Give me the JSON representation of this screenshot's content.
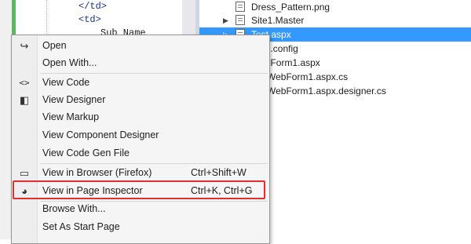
{
  "editor": {
    "lines": [
      "</td>",
      "<td>",
      "Sub_Name"
    ]
  },
  "solution_explorer": {
    "items": [
      {
        "label": "Dress_Pattern.png",
        "selected": false
      },
      {
        "label": "Site1.Master",
        "selected": false
      },
      {
        "label": "Test.aspx",
        "selected": true
      },
      {
        "label": "Web.config",
        "selected": false
      },
      {
        "label": "WebForm1.aspx",
        "selected": false
      },
      {
        "label": "WebForm1.aspx.cs",
        "selected": false
      },
      {
        "label": "WebForm1.aspx.designer.cs",
        "selected": false
      }
    ]
  },
  "context_menu": {
    "items": [
      {
        "label": "Open",
        "shortcut": "",
        "icon": "open-icon"
      },
      {
        "label": "Open With...",
        "shortcut": "",
        "icon": ""
      },
      {
        "label": "View Code",
        "shortcut": "",
        "icon": "code-icon"
      },
      {
        "label": "View Designer",
        "shortcut": "",
        "icon": "designer-icon"
      },
      {
        "label": "View Markup",
        "shortcut": "",
        "icon": ""
      },
      {
        "label": "View Component Designer",
        "shortcut": "",
        "icon": ""
      },
      {
        "label": "View Code Gen File",
        "shortcut": "",
        "icon": ""
      },
      {
        "label": "View in Browser (Firefox)",
        "shortcut": "Ctrl+Shift+W",
        "icon": "browser-icon"
      },
      {
        "label": "View in Page Inspector",
        "shortcut": "Ctrl+K, Ctrl+G",
        "icon": "page-inspector-icon"
      },
      {
        "label": "Browse With...",
        "shortcut": "",
        "icon": ""
      },
      {
        "label": "Set As Start Page",
        "shortcut": "",
        "icon": ""
      }
    ],
    "highlighted_item": "View in Page Inspector",
    "highlight_color": "#e03030"
  },
  "colors": {
    "selection": "#3399ff",
    "change_bar": "#5fb85f"
  }
}
